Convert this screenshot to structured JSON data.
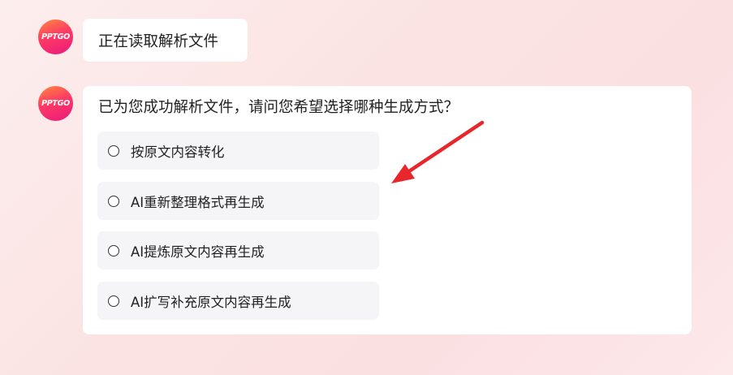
{
  "avatar": {
    "text": "PPTGO"
  },
  "messages": [
    {
      "text": "正在读取解析文件"
    },
    {
      "question": "已为您成功解析文件，请问您希望选择哪种生成方式？",
      "options": [
        {
          "label": "按原文内容转化",
          "selected": false
        },
        {
          "label": "AI重新整理格式再生成",
          "selected": false
        },
        {
          "label": "AI提炼原文内容再生成",
          "selected": false
        },
        {
          "label": "AI扩写补充原文内容再生成",
          "selected": false
        }
      ]
    }
  ],
  "colors": {
    "avatar_gradient_start": "#ff8a3d",
    "avatar_gradient_end": "#e8197d",
    "annotation_arrow": "#e8262b",
    "option_background": "#f5f5f7"
  },
  "icons": {
    "radio": "radio-unchecked-icon",
    "annotation": "red-arrow-icon"
  }
}
